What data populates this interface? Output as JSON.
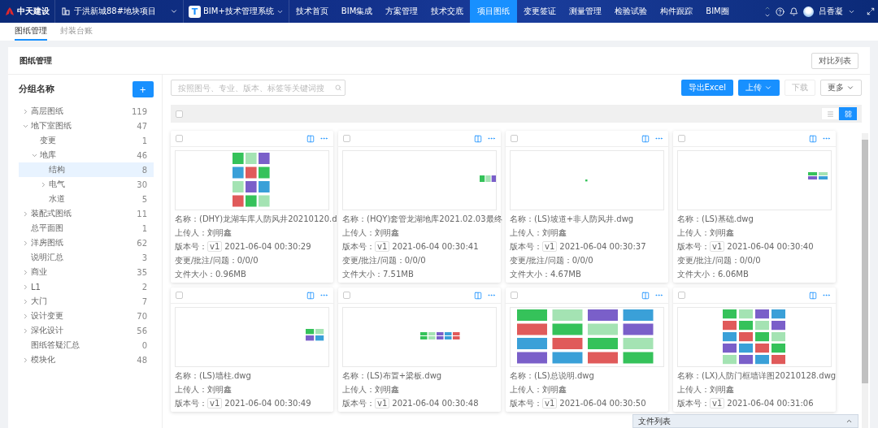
{
  "topbar": {
    "logo": "中天建设",
    "project": "于洪新城88#地块项目",
    "system_badge": "T",
    "system": "BIM+技术管理系统",
    "user": "吕香凝",
    "nav": [
      {
        "label": "技术首页",
        "selected": false
      },
      {
        "label": "BIM集成",
        "selected": false
      },
      {
        "label": "方案管理",
        "selected": false
      },
      {
        "label": "技术交底",
        "selected": false
      },
      {
        "label": "项目图纸",
        "selected": true
      },
      {
        "label": "变更签证",
        "selected": false
      },
      {
        "label": "测量管理",
        "selected": false
      },
      {
        "label": "检验试验",
        "selected": false
      },
      {
        "label": "构件跟踪",
        "selected": false
      },
      {
        "label": "BIM圈",
        "selected": false
      }
    ]
  },
  "subtabs": [
    {
      "label": "图纸管理",
      "selected": true
    },
    {
      "label": "封装台账",
      "selected": false
    }
  ],
  "page": {
    "title": "图纸管理",
    "compare_button": "对比列表"
  },
  "groups": {
    "title": "分组名称",
    "add_button": "+",
    "items": [
      {
        "kind": "group",
        "label": "高层图纸",
        "count": "119",
        "expanded": false,
        "selected": false
      },
      {
        "kind": "group",
        "label": "地下室图纸",
        "count": "47",
        "expanded": true,
        "selected": false,
        "children": [
          {
            "kind": "leaf",
            "label": "变更",
            "count": "1",
            "selected": false
          },
          {
            "kind": "group",
            "label": "地库",
            "count": "46",
            "expanded": true,
            "selected": false,
            "children": [
              {
                "kind": "leaf",
                "label": "结构",
                "count": "8",
                "selected": true
              },
              {
                "kind": "group",
                "label": "电气",
                "count": "30",
                "expanded": false,
                "selected": false
              },
              {
                "kind": "leaf",
                "label": "水道",
                "count": "5",
                "selected": false
              }
            ]
          }
        ]
      },
      {
        "kind": "group",
        "label": "装配式图纸",
        "count": "11",
        "expanded": false,
        "selected": false
      },
      {
        "kind": "leaf",
        "label": "总平面图",
        "count": "1",
        "selected": false
      },
      {
        "kind": "group",
        "label": "洋房图纸",
        "count": "62",
        "expanded": false,
        "selected": false
      },
      {
        "kind": "leaf",
        "label": "说明汇总",
        "count": "3",
        "selected": false
      },
      {
        "kind": "group",
        "label": "商业",
        "count": "35",
        "expanded": false,
        "selected": false
      },
      {
        "kind": "group",
        "label": "L1",
        "count": "2",
        "expanded": false,
        "selected": false
      },
      {
        "kind": "group",
        "label": "大门",
        "count": "7",
        "expanded": false,
        "selected": false
      },
      {
        "kind": "group",
        "label": "设计变更",
        "count": "70",
        "expanded": false,
        "selected": false
      },
      {
        "kind": "group",
        "label": "深化设计",
        "count": "56",
        "expanded": false,
        "selected": false
      },
      {
        "kind": "leaf",
        "label": "图纸答疑汇总",
        "count": "0",
        "selected": false
      },
      {
        "kind": "group",
        "label": "模块化",
        "count": "48",
        "expanded": false,
        "selected": false
      }
    ]
  },
  "toolbar": {
    "search": {
      "placeholder": "按照图号、专业、版本、标签等关键词搜"
    },
    "export_button": "导出Excel",
    "upload_button": "上传",
    "download_button": "下载",
    "more_button": "更多",
    "download_disabled": true
  },
  "select_all": {
    "checked": false
  },
  "view_modes": [
    {
      "kind": "list",
      "selected": false
    },
    {
      "kind": "grid",
      "selected": true
    }
  ],
  "cards": [
    {
      "checked": false,
      "fields": [
        {
          "kind": "text",
          "label": "名称：",
          "value": "(DHY)龙湖车库人防风井20210120.d"
        },
        {
          "kind": "text",
          "label": "上传人：",
          "value": "刘明鑫"
        },
        {
          "kind": "version",
          "label": "版本号：",
          "badge": "v1",
          "value": "2021-06-04 00:30:29"
        },
        {
          "kind": "text",
          "label": "变更/批注/问题：",
          "value": "0/0/0"
        },
        {
          "kind": "text",
          "label": "文件大小：",
          "value": "0.96MB"
        }
      ]
    },
    {
      "checked": false,
      "fields": [
        {
          "kind": "text",
          "label": "名称：",
          "value": "(HQY)套管龙湖地库2021.02.03最终"
        },
        {
          "kind": "text",
          "label": "上传人：",
          "value": "刘明鑫"
        },
        {
          "kind": "version",
          "label": "版本号：",
          "badge": "v1",
          "value": "2021-06-04 00:30:41"
        },
        {
          "kind": "text",
          "label": "变更/批注/问题：",
          "value": "0/0/0"
        },
        {
          "kind": "text",
          "label": "文件大小：",
          "value": "7.51MB"
        }
      ]
    },
    {
      "checked": false,
      "fields": [
        {
          "kind": "text",
          "label": "名称：",
          "value": "(LS)坡道+非人防风井.dwg"
        },
        {
          "kind": "text",
          "label": "上传人：",
          "value": "刘明鑫"
        },
        {
          "kind": "version",
          "label": "版本号：",
          "badge": "v1",
          "value": "2021-06-04 00:30:37"
        },
        {
          "kind": "text",
          "label": "变更/批注/问题：",
          "value": "0/0/0"
        },
        {
          "kind": "text",
          "label": "文件大小：",
          "value": "4.67MB"
        }
      ]
    },
    {
      "checked": false,
      "fields": [
        {
          "kind": "text",
          "label": "名称：",
          "value": "(LS)基础.dwg"
        },
        {
          "kind": "text",
          "label": "上传人：",
          "value": "刘明鑫"
        },
        {
          "kind": "version",
          "label": "版本号：",
          "badge": "v1",
          "value": "2021-06-04 00:30:40"
        },
        {
          "kind": "text",
          "label": "变更/批注/问题：",
          "value": "0/0/0"
        },
        {
          "kind": "text",
          "label": "文件大小：",
          "value": "6.06MB"
        }
      ]
    },
    {
      "checked": false,
      "fields": [
        {
          "kind": "text",
          "label": "名称：",
          "value": "(LS)墙柱.dwg"
        },
        {
          "kind": "text",
          "label": "上传人：",
          "value": "刘明鑫"
        },
        {
          "kind": "version",
          "label": "版本号：",
          "badge": "v1",
          "value": "2021-06-04 00:30:49"
        }
      ]
    },
    {
      "checked": false,
      "fields": [
        {
          "kind": "text",
          "label": "名称：",
          "value": "(LS)布置+梁板.dwg"
        },
        {
          "kind": "text",
          "label": "上传人：",
          "value": "刘明鑫"
        },
        {
          "kind": "version",
          "label": "版本号：",
          "badge": "v1",
          "value": "2021-06-04 00:30:48"
        }
      ]
    },
    {
      "checked": false,
      "fields": [
        {
          "kind": "text",
          "label": "名称：",
          "value": "(LS)总说明.dwg"
        },
        {
          "kind": "text",
          "label": "上传人：",
          "value": "刘明鑫"
        },
        {
          "kind": "version",
          "label": "版本号：",
          "badge": "v1",
          "value": "2021-06-04 00:30:50"
        }
      ]
    },
    {
      "checked": false,
      "fields": [
        {
          "kind": "text",
          "label": "名称：",
          "value": "(LX)人防门框墙详图20210128.dwg"
        },
        {
          "kind": "text",
          "label": "上传人：",
          "value": "刘明鑫"
        },
        {
          "kind": "version",
          "label": "版本号：",
          "badge": "v1",
          "value": "2021-06-04 00:31:06"
        }
      ]
    }
  ],
  "file_list_panel": {
    "title": "文件列表",
    "expanded": false
  }
}
